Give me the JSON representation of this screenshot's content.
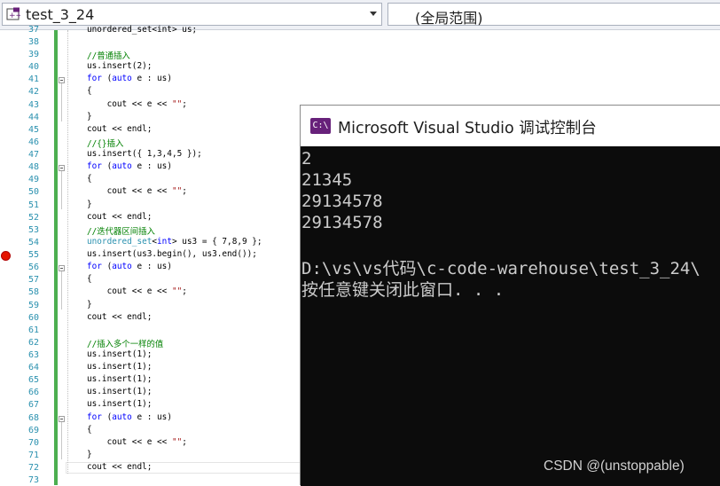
{
  "toolbar": {
    "project_combo": "test_3_24",
    "scope_combo": "(全局范围)"
  },
  "editor": {
    "top_partial_code": "unordered_set<int> us;",
    "lines": [
      {
        "n": "38",
        "code": []
      },
      {
        "n": "39",
        "code": [
          {
            "t": "//普通插入",
            "c": "cm"
          }
        ]
      },
      {
        "n": "40",
        "code": [
          {
            "t": "us.insert(2);",
            "c": ""
          }
        ]
      },
      {
        "n": "41",
        "code": [
          {
            "t": "for",
            "c": "kw"
          },
          {
            "t": " (",
            "c": ""
          },
          {
            "t": "auto",
            "c": "kw"
          },
          {
            "t": " e : us)",
            "c": ""
          }
        ]
      },
      {
        "n": "42",
        "code": [
          {
            "t": "{",
            "c": ""
          }
        ]
      },
      {
        "n": "43",
        "code": [
          {
            "t": "    cout << e << ",
            "c": ""
          },
          {
            "t": "\"\"",
            "c": "st"
          },
          {
            "t": ";",
            "c": ""
          }
        ]
      },
      {
        "n": "44",
        "code": [
          {
            "t": "}",
            "c": ""
          }
        ]
      },
      {
        "n": "45",
        "code": [
          {
            "t": "cout << endl;",
            "c": ""
          }
        ]
      },
      {
        "n": "46",
        "code": [
          {
            "t": "//{}插入",
            "c": "cm"
          }
        ]
      },
      {
        "n": "47",
        "code": [
          {
            "t": "us.insert({ 1,3,4,5 });",
            "c": ""
          }
        ]
      },
      {
        "n": "48",
        "code": [
          {
            "t": "for",
            "c": "kw"
          },
          {
            "t": " (",
            "c": ""
          },
          {
            "t": "auto",
            "c": "kw"
          },
          {
            "t": " e : us)",
            "c": ""
          }
        ]
      },
      {
        "n": "49",
        "code": [
          {
            "t": "{",
            "c": ""
          }
        ]
      },
      {
        "n": "50",
        "code": [
          {
            "t": "    cout << e << ",
            "c": ""
          },
          {
            "t": "\"\"",
            "c": "st"
          },
          {
            "t": ";",
            "c": ""
          }
        ]
      },
      {
        "n": "51",
        "code": [
          {
            "t": "}",
            "c": ""
          }
        ]
      },
      {
        "n": "52",
        "code": [
          {
            "t": "cout << endl;",
            "c": ""
          }
        ]
      },
      {
        "n": "53",
        "code": [
          {
            "t": "//迭代器区间插入",
            "c": "cm"
          }
        ]
      },
      {
        "n": "54",
        "code": [
          {
            "t": "unordered_set",
            "c": "ty"
          },
          {
            "t": "<",
            "c": ""
          },
          {
            "t": "int",
            "c": "kw"
          },
          {
            "t": "> us3 = { 7,8,9 };",
            "c": ""
          }
        ]
      },
      {
        "n": "55",
        "code": [
          {
            "t": "us.insert(us3.begin(), us3.end());",
            "c": ""
          }
        ]
      },
      {
        "n": "56",
        "code": [
          {
            "t": "for",
            "c": "kw"
          },
          {
            "t": " (",
            "c": ""
          },
          {
            "t": "auto",
            "c": "kw"
          },
          {
            "t": " e : us)",
            "c": ""
          }
        ]
      },
      {
        "n": "57",
        "code": [
          {
            "t": "{",
            "c": ""
          }
        ]
      },
      {
        "n": "58",
        "code": [
          {
            "t": "    cout << e << ",
            "c": ""
          },
          {
            "t": "\"\"",
            "c": "st"
          },
          {
            "t": ";",
            "c": ""
          }
        ]
      },
      {
        "n": "59",
        "code": [
          {
            "t": "}",
            "c": ""
          }
        ]
      },
      {
        "n": "60",
        "code": [
          {
            "t": "cout << endl;",
            "c": ""
          }
        ]
      },
      {
        "n": "61",
        "code": []
      },
      {
        "n": "62",
        "code": [
          {
            "t": "//插入多个一样的值",
            "c": "cm"
          }
        ]
      },
      {
        "n": "63",
        "code": [
          {
            "t": "us.insert(1);",
            "c": ""
          }
        ]
      },
      {
        "n": "64",
        "code": [
          {
            "t": "us.insert(1);",
            "c": ""
          }
        ]
      },
      {
        "n": "65",
        "code": [
          {
            "t": "us.insert(1);",
            "c": ""
          }
        ]
      },
      {
        "n": "66",
        "code": [
          {
            "t": "us.insert(1);",
            "c": ""
          }
        ]
      },
      {
        "n": "67",
        "code": [
          {
            "t": "us.insert(1);",
            "c": ""
          }
        ]
      },
      {
        "n": "68",
        "code": [
          {
            "t": "for",
            "c": "kw"
          },
          {
            "t": " (",
            "c": ""
          },
          {
            "t": "auto",
            "c": "kw"
          },
          {
            "t": " e : us)",
            "c": ""
          }
        ]
      },
      {
        "n": "69",
        "code": [
          {
            "t": "{",
            "c": ""
          }
        ]
      },
      {
        "n": "70",
        "code": [
          {
            "t": "    cout << e << ",
            "c": ""
          },
          {
            "t": "\"\"",
            "c": "st"
          },
          {
            "t": ";",
            "c": ""
          }
        ]
      },
      {
        "n": "71",
        "code": [
          {
            "t": "}",
            "c": ""
          }
        ]
      },
      {
        "n": "72",
        "code": [
          {
            "t": "cout << endl;",
            "c": ""
          }
        ]
      },
      {
        "n": "73",
        "code": []
      }
    ],
    "breakpoint_line": "55"
  },
  "console": {
    "title": "Microsoft Visual Studio 调试控制台",
    "icon_text": "C:\\",
    "output_lines": [
      "2",
      "21345",
      "29134578",
      "29134578",
      "",
      "D:\\vs\\vs代码\\c-code-warehouse\\test_3_24\\",
      "按任意键关闭此窗口. . ."
    ],
    "watermark": "CSDN @(unstoppable)"
  },
  "colors": {
    "keyword": "#0000ff",
    "type": "#2b91af",
    "comment": "#008000",
    "string": "#a31515",
    "breakpoint": "#e51400",
    "changebar": "#4caf50",
    "console_bg": "#0c0c0c"
  },
  "icons": {
    "project": "cpp-project-icon",
    "console": "vs-console-icon",
    "breakpoint": "breakpoint-icon",
    "dropdown": "chevron-down-icon"
  }
}
